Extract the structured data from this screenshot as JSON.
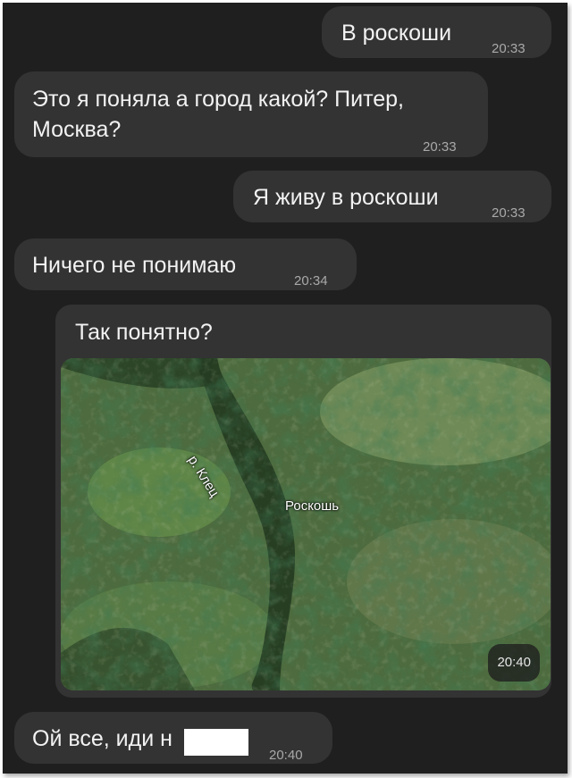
{
  "messages": [
    {
      "text": "В роскоши",
      "time": "20:33",
      "direction": "outgoing"
    },
    {
      "text": "Это я поняла а город какой? Питер,\nМосква?",
      "time": "20:33",
      "direction": "incoming"
    },
    {
      "text": "Я живу в роскоши",
      "time": "20:33",
      "direction": "outgoing"
    },
    {
      "text": "Ничего не понимаю",
      "time": "20:34",
      "direction": "incoming"
    },
    {
      "text": "Так понятно?",
      "time": "20:40",
      "direction": "outgoing",
      "attachment": {
        "type": "map-image",
        "labels": {
          "river": "р. Клец",
          "place": "Роскошь"
        }
      }
    },
    {
      "text": "Ой все, иди н",
      "time": "20:40",
      "direction": "incoming",
      "redacted": true
    }
  ],
  "colors": {
    "background": "#1f1f1f",
    "bubble": "#333333",
    "text": "#f2f2f2",
    "time": "#a9a9a9"
  }
}
